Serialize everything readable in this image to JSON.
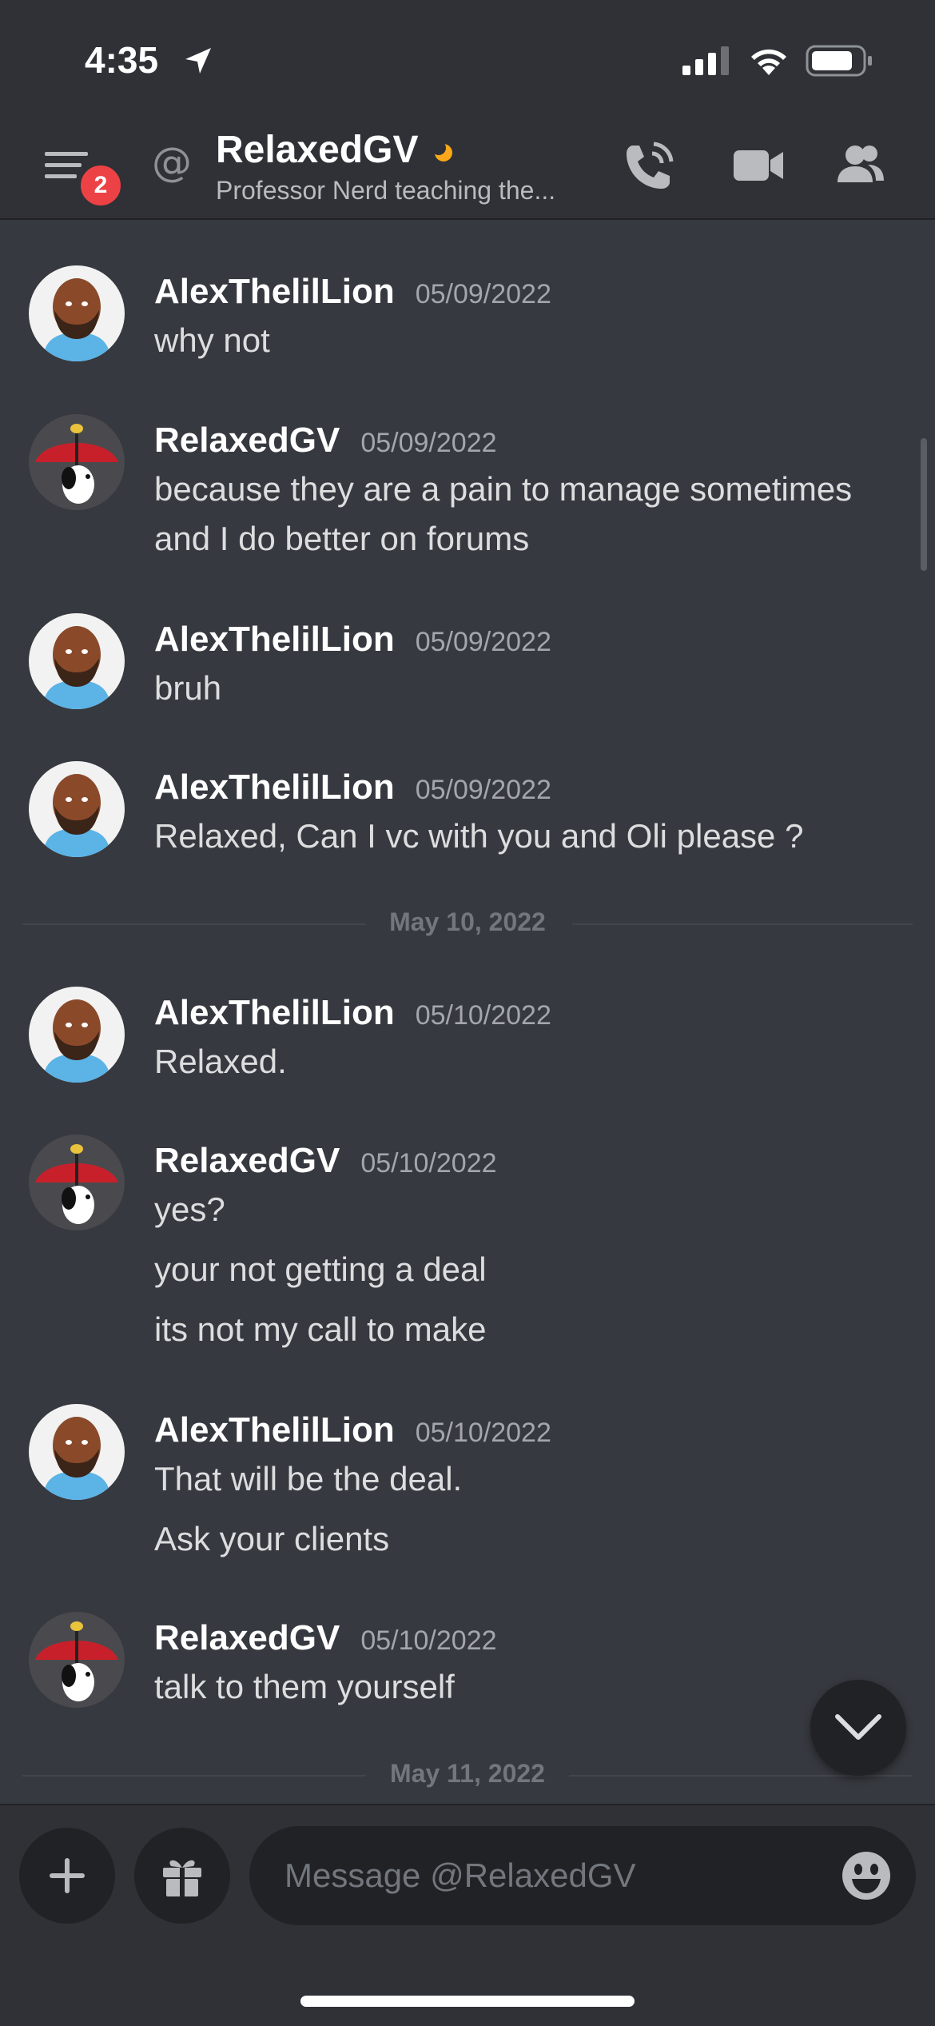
{
  "status_bar": {
    "time": "4:35"
  },
  "header": {
    "notification_count": "2",
    "title": "RelaxedGV",
    "subtitle": "Professor Nerd teaching the..."
  },
  "messages": [
    {
      "author": "AlexThelilLion",
      "timestamp": "05/09/2022",
      "lines": [
        "why not"
      ]
    },
    {
      "author": "RelaxedGV",
      "timestamp": "05/09/2022",
      "lines": [
        "because they are a pain to manage sometimes",
        "and I do better on forums"
      ]
    },
    {
      "author": "AlexThelilLion",
      "timestamp": "05/09/2022",
      "lines": [
        "bruh"
      ]
    },
    {
      "author": "AlexThelilLion",
      "timestamp": "05/09/2022",
      "lines": [
        "Relaxed, Can I vc with you and Oli please ?"
      ]
    },
    {
      "author": "AlexThelilLion",
      "timestamp": "05/10/2022",
      "lines": [
        "Relaxed."
      ]
    },
    {
      "author": "RelaxedGV",
      "timestamp": "05/10/2022",
      "lines": [
        "yes?",
        "your not getting a deal",
        "its not my call to make"
      ]
    },
    {
      "author": "AlexThelilLion",
      "timestamp": "05/10/2022",
      "lines": [
        "That will be the deal.",
        "Ask your clients"
      ]
    },
    {
      "author": "RelaxedGV",
      "timestamp": "05/10/2022",
      "lines": [
        "talk to them yourself"
      ]
    }
  ],
  "dividers": [
    "May 10, 2022",
    "May 11, 2022"
  ],
  "composer": {
    "placeholder": "Message @RelaxedGV"
  },
  "colors": {
    "background": "#36393f",
    "header": "#2f3136",
    "badge": "#ed4245",
    "idle_status": "#faa81a"
  },
  "icons": [
    "location-arrow-icon",
    "signal-icon",
    "wifi-icon",
    "battery-icon",
    "hamburger-menu-icon",
    "at-icon",
    "idle-moon-icon",
    "phone-call-icon",
    "video-camera-icon",
    "members-icon",
    "chevron-down-icon",
    "plus-icon",
    "gift-icon",
    "emoji-icon"
  ]
}
